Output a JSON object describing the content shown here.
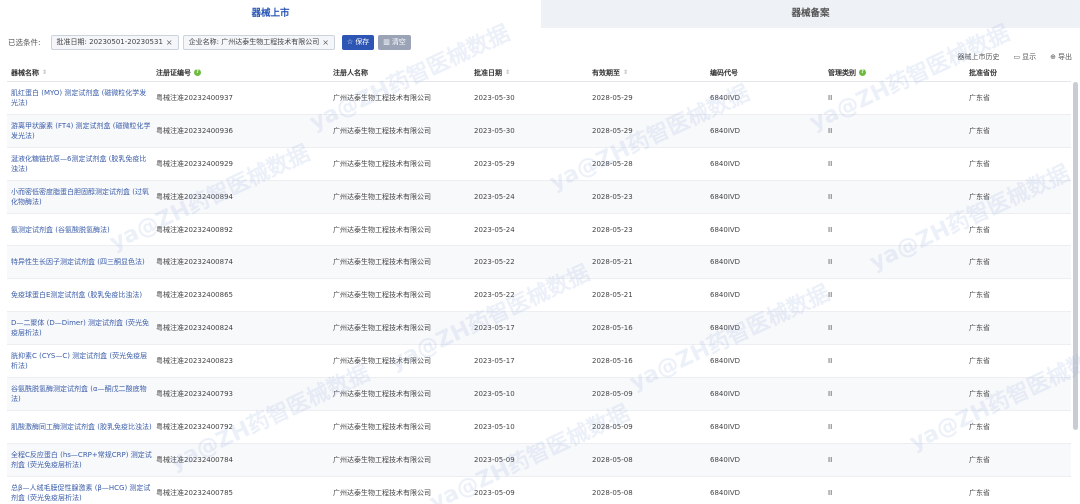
{
  "tabs": [
    {
      "label": "器械上市"
    },
    {
      "label": "器械备案"
    }
  ],
  "filters": {
    "label": "已选条件:",
    "chips": [
      {
        "text": "批准日期: 20230501-20230531"
      },
      {
        "text": "企业名称: 广州达泰生物工程技术有限公司"
      }
    ],
    "save_label": "保存",
    "clear_label": "清空"
  },
  "tools": {
    "history": "器械上市历史",
    "display": "显示",
    "export": "导出"
  },
  "columns": [
    "器械名称",
    "注册证编号",
    "注册人名称",
    "批准日期",
    "有效期至",
    "编码代号",
    "管理类别",
    "批准省份"
  ],
  "rows": [
    {
      "name": "肌红蛋白 (MYO) 测定试剂盒 (磁微粒化学发光法)",
      "cert": "粤械注准20232400937",
      "company": "广州达泰生物工程技术有限公司",
      "approval": "2023-05-30",
      "expiry": "2028-05-29",
      "code": "6840IVD",
      "class": "II",
      "province": "广东省"
    },
    {
      "name": "游离甲状腺素 (FT4) 测定试剂盒 (磁微粒化学发光法)",
      "cert": "粤械注准20232400936",
      "company": "广州达泰生物工程技术有限公司",
      "approval": "2023-05-30",
      "expiry": "2028-05-29",
      "code": "6840IVD",
      "class": "II",
      "province": "广东省"
    },
    {
      "name": "涎液化糖链抗原—6测定试剂盒 (胶乳免疫比浊法)",
      "cert": "粤械注准20232400929",
      "company": "广州达泰生物工程技术有限公司",
      "approval": "2023-05-29",
      "expiry": "2028-05-28",
      "code": "6840IVD",
      "class": "II",
      "province": "广东省"
    },
    {
      "name": "小而密低密度脂蛋白胆固醇测定试剂盒 (过氧化物酶法)",
      "cert": "粤械注准20232400894",
      "company": "广州达泰生物工程技术有限公司",
      "approval": "2023-05-24",
      "expiry": "2028-05-23",
      "code": "6840IVD",
      "class": "II",
      "province": "广东省"
    },
    {
      "name": "氨测定试剂盒 (谷氨酸脱氢酶法)",
      "cert": "粤械注准20232400892",
      "company": "广州达泰生物工程技术有限公司",
      "approval": "2023-05-24",
      "expiry": "2028-05-23",
      "code": "6840IVD",
      "class": "II",
      "province": "广东省"
    },
    {
      "name": "特异性生长因子测定试剂盒 (四三酮显色法)",
      "cert": "粤械注准20232400874",
      "company": "广州达泰生物工程技术有限公司",
      "approval": "2023-05-22",
      "expiry": "2028-05-21",
      "code": "6840IVD",
      "class": "II",
      "province": "广东省"
    },
    {
      "name": "免疫球蛋白E测定试剂盒 (胶乳免疫比浊法)",
      "cert": "粤械注准20232400865",
      "company": "广州达泰生物工程技术有限公司",
      "approval": "2023-05-22",
      "expiry": "2028-05-21",
      "code": "6840IVD",
      "class": "II",
      "province": "广东省"
    },
    {
      "name": "D—二聚体 (D—Dimer) 测定试剂盒 (荧光免疫层析法)",
      "cert": "粤械注准20232400824",
      "company": "广州达泰生物工程技术有限公司",
      "approval": "2023-05-17",
      "expiry": "2028-05-16",
      "code": "6840IVD",
      "class": "II",
      "province": "广东省"
    },
    {
      "name": "胱抑素C (CYS—C) 测定试剂盒 (荧光免疫层析法)",
      "cert": "粤械注准20232400823",
      "company": "广州达泰生物工程技术有限公司",
      "approval": "2023-05-17",
      "expiry": "2028-05-16",
      "code": "6840IVD",
      "class": "II",
      "province": "广东省"
    },
    {
      "name": "谷氨酰脱氢酶测定试剂盒 (α—酮戊二酸底物法)",
      "cert": "粤械注准20232400793",
      "company": "广州达泰生物工程技术有限公司",
      "approval": "2023-05-10",
      "expiry": "2028-05-09",
      "code": "6840IVD",
      "class": "II",
      "province": "广东省"
    },
    {
      "name": "肌酸激酶同工酶测定试剂盒 (胶乳免疫比浊法)",
      "cert": "粤械注准20232400792",
      "company": "广州达泰生物工程技术有限公司",
      "approval": "2023-05-10",
      "expiry": "2028-05-09",
      "code": "6840IVD",
      "class": "II",
      "province": "广东省"
    },
    {
      "name": "全程C反应蛋白 (hs—CRP+常规CRP) 测定试剂盒 (荧光免疫层析法)",
      "cert": "粤械注准20232400784",
      "company": "广州达泰生物工程技术有限公司",
      "approval": "2023-05-09",
      "expiry": "2028-05-08",
      "code": "6840IVD",
      "class": "II",
      "province": "广东省"
    },
    {
      "name": "总β—人绒毛膜促性腺激素 (β—HCG) 测定试剂盒 (荧光免疫层析法)",
      "cert": "粤械注准20232400785",
      "company": "广州达泰生物工程技术有限公司",
      "approval": "2023-05-09",
      "expiry": "2028-05-08",
      "code": "6840IVD",
      "class": "II",
      "province": "广东省"
    }
  ],
  "watermark": "ya@ZH药智医械数据"
}
